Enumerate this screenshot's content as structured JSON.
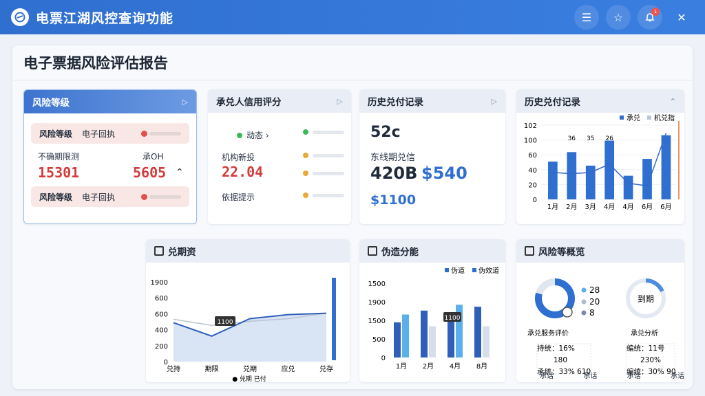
{
  "app": {
    "title": "电票江湖风控查询功能",
    "notification_count": "1"
  },
  "page": {
    "title": "电子票据风险评估报告"
  },
  "card_risk": {
    "title": "风险等级",
    "row1": {
      "label": "风险等级",
      "value": "电子回执"
    },
    "mid_left_label": "不确期限测",
    "mid_right_label": "承OH",
    "num_left": "15301",
    "num_right": "5605",
    "row2": {
      "label": "风险等级",
      "value": "电子回执"
    }
  },
  "card_credit": {
    "title": "承兑人信用评分",
    "items": [
      {
        "label": "动态 ›",
        "dot": "#3bb85a"
      },
      {
        "label": "",
        "dot": "#3bb85a"
      },
      {
        "label": "",
        "dot": "#e8a93a"
      },
      {
        "label": "",
        "dot": "#e8a93a"
      }
    ],
    "sub_label": "机构新投",
    "score": "22.04",
    "foot_label": "依据提示"
  },
  "card_history1": {
    "title": "历史兑付记录",
    "top_value": "52c",
    "sub_label": "东线期兑信",
    "amount1": "420B",
    "amount2": "$540",
    "amount3": "$1100"
  },
  "card_history2": {
    "title": "历史兑付记录",
    "legend": [
      "承兑",
      "机兑指"
    ],
    "chart_data": {
      "type": "bar",
      "categories": [
        "1月",
        "2月",
        "3月",
        "4月",
        "4月",
        "6月",
        "6月"
      ],
      "values": [
        56,
        70,
        50,
        87,
        35,
        60,
        95
      ],
      "line": [
        40,
        38,
        40,
        52,
        24,
        20,
        98
      ],
      "labels": [
        "",
        "36",
        "35",
        "26",
        "",
        "",
        "",
        ""
      ],
      "yticks": [
        "0",
        "20",
        "40",
        "60",
        "100",
        "102"
      ],
      "ylim": [
        0,
        110
      ]
    }
  },
  "card_area": {
    "title": "兑期资",
    "tooltip": "1100",
    "legend": "兑期 已付",
    "chart_data": {
      "type": "area",
      "categories": [
        "兑持",
        "期限",
        "兑期",
        "应兑",
        "兑存"
      ],
      "series": [
        {
          "name": "",
          "values": [
            580,
            380,
            640,
            700,
            720
          ]
        },
        {
          "name": "",
          "values": [
            630,
            540,
            600,
            640,
            720
          ]
        }
      ],
      "yticks": [
        "0",
        "200",
        "400",
        "600",
        "600",
        "1900"
      ],
      "ylim": [
        0,
        1900
      ]
    }
  },
  "card_dist": {
    "title": "伪造分能",
    "legend": [
      "伪道",
      "伪效道"
    ],
    "tooltip": "1100",
    "chart_data": {
      "type": "bar",
      "categories": [
        "1月",
        "2月",
        "4月",
        "8月"
      ],
      "series": [
        {
          "name": "伪道",
          "values": [
            900,
            1200,
            1100,
            1300
          ]
        },
        {
          "name": "伪效道",
          "values": [
            1100,
            800,
            1350,
            800
          ]
        }
      ],
      "yticks": [
        "0",
        "500",
        "1500",
        "1900",
        "1500"
      ],
      "ylim": [
        0,
        1900
      ]
    }
  },
  "card_overview": {
    "title": "风险等概览",
    "donut_left": {
      "legend": [
        "28",
        "20",
        "8"
      ],
      "caption": "承兑服务评价"
    },
    "donut_right": {
      "center": "到期",
      "caption": "承兑分析"
    },
    "left_rows": [
      "持统：16%",
      "180",
      "承统：33%  610"
    ],
    "right_rows": [
      "编统：11号",
      "230%",
      "编统：30%  90"
    ],
    "footer": [
      "承话",
      "承话",
      "承话",
      "承话"
    ]
  }
}
